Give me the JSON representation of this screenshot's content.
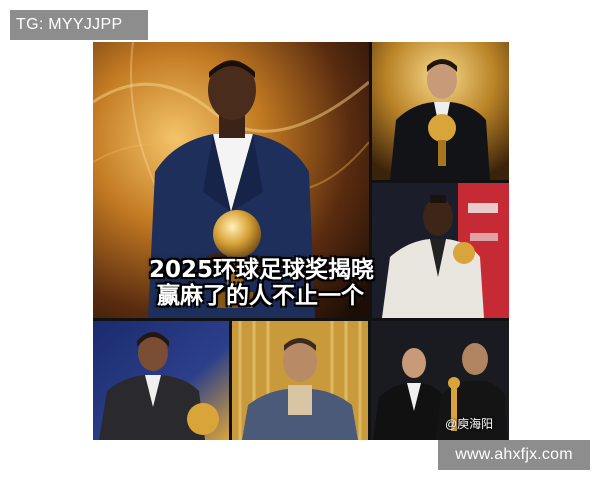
{
  "top_badge": {
    "text": "TG: MYYJJPP"
  },
  "headline": {
    "line1": "2025环球足球奖揭晓",
    "line2": "赢麻了的人不止一个"
  },
  "photo_watermark": {
    "text": "@庾海阳"
  },
  "site_badge": {
    "text": "www.ahxfjx.com"
  },
  "colors": {
    "gold": "#d9a43a",
    "suit_navy": "#1e2f5c",
    "badge_gray": "#8d8d8d"
  }
}
